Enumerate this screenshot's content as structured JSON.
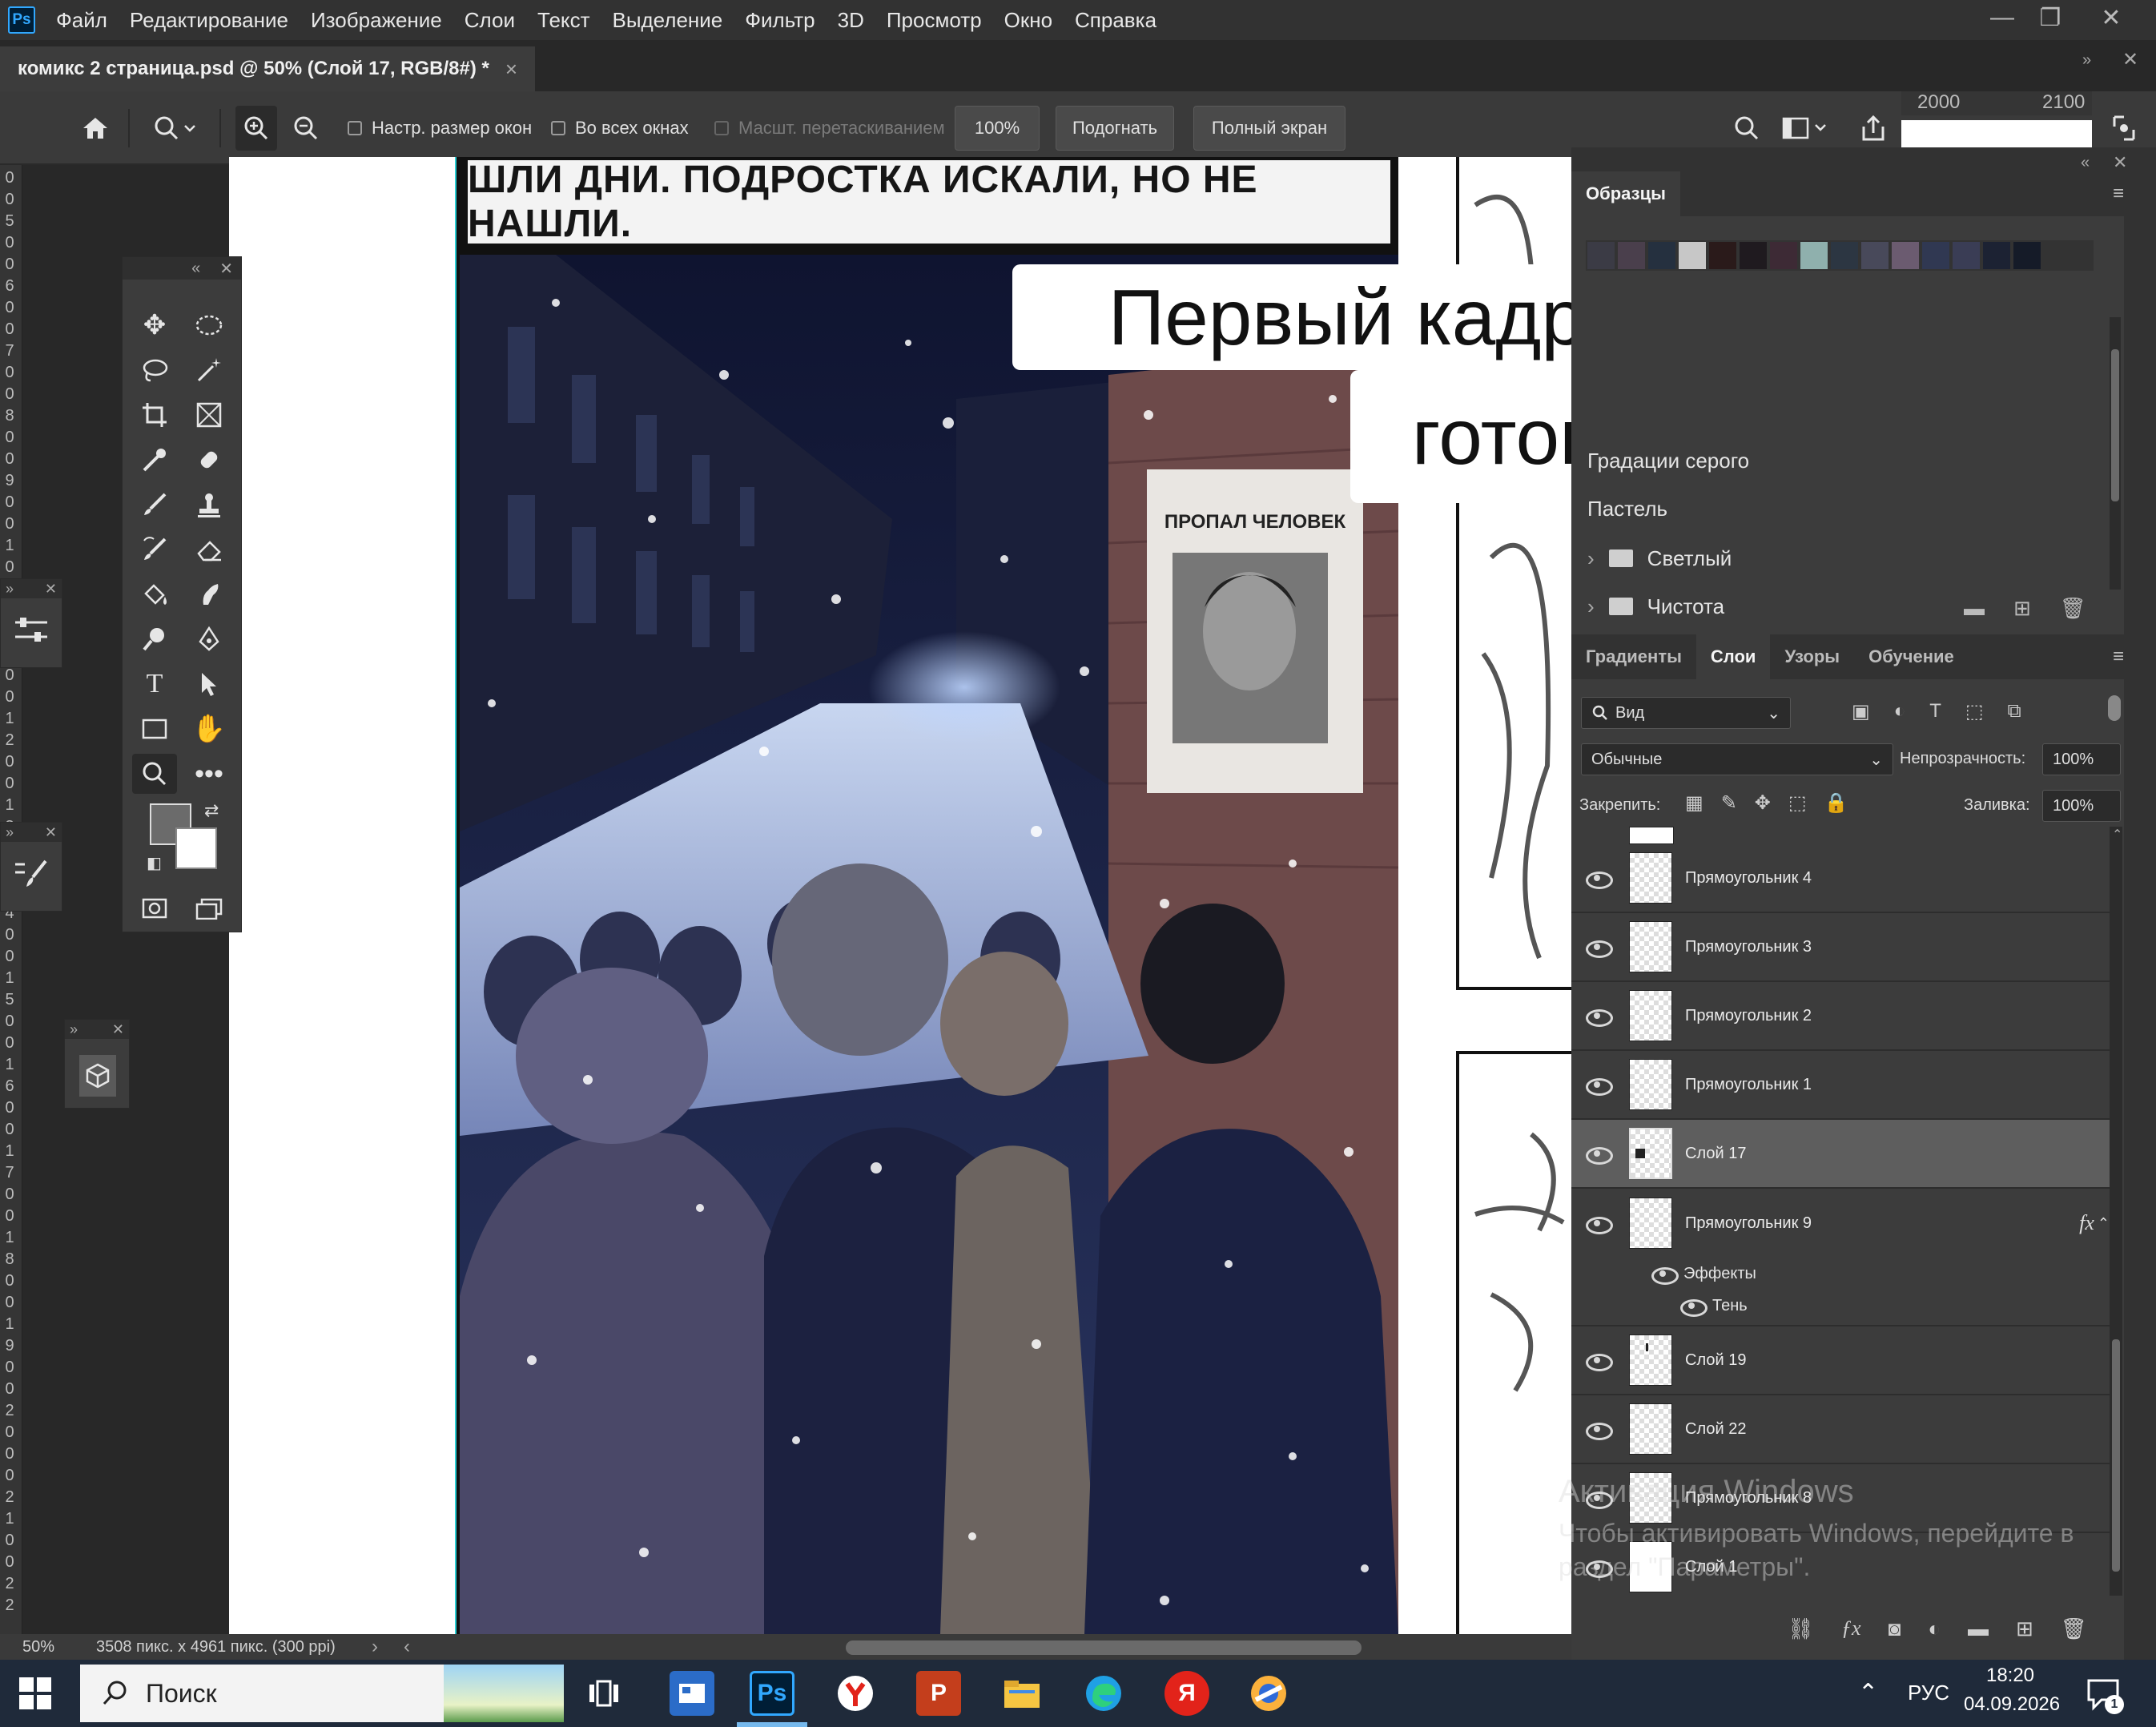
{
  "app": {
    "logo": "Ps",
    "menu": [
      "Файл",
      "Редактирование",
      "Изображение",
      "Слои",
      "Текст",
      "Выделение",
      "Фильтр",
      "3D",
      "Просмотр",
      "Окно",
      "Справка"
    ]
  },
  "document": {
    "tab_title": "комикс 2 страница.psd @ 50% (Слой 17, RGB/8#) *",
    "close_glyph": "×"
  },
  "options": {
    "resize_windows": "Настр. размер окон",
    "all_windows": "Во всех окнах",
    "scrubby_zoom": "Масшт. перетаскиванием",
    "zoom_value": "100%",
    "fit": "Подогнать",
    "fullscreen": "Полный экран"
  },
  "ruler": {
    "top_labels": [
      "2000",
      "2100"
    ],
    "left_labels": [
      "0",
      "0",
      "5",
      "0",
      "0",
      "6",
      "0",
      "0",
      "7",
      "0",
      "0",
      "8",
      "0",
      "0",
      "9",
      "0",
      "0",
      "1",
      "0",
      "0",
      "0",
      "1",
      "1",
      "0",
      "0",
      "1",
      "2",
      "0",
      "0",
      "1",
      "3",
      "0",
      "0",
      "1",
      "4",
      "0",
      "0",
      "1",
      "5",
      "0",
      "0",
      "1",
      "6",
      "0",
      "0",
      "1",
      "7",
      "0",
      "0",
      "1",
      "8",
      "0",
      "0",
      "1",
      "9",
      "0",
      "0",
      "2",
      "0",
      "0",
      "0",
      "2",
      "1",
      "0",
      "0",
      "2",
      "2"
    ]
  },
  "canvas": {
    "caption": "ШЛИ ДНИ. ПОДРОСТКА ИСКАЛИ, НО НЕ НАШЛИ.",
    "poster_title": "ПРОПАЛ ЧЕЛОВЕК"
  },
  "overlay": {
    "line1": "Первый кадр комикса",
    "line2": "готов"
  },
  "swatches_panel": {
    "tab": "Образцы",
    "colors": [
      "#3b3b45",
      "#4a3f4c",
      "#25303f",
      "#c7c7c7",
      "#2a1a1a",
      "#1f1a1f",
      "#3d2a35",
      "#8fb0ad",
      "#2c3642",
      "#48495a",
      "#6b5b70",
      "#303852",
      "#3a3d55",
      "#1c2233",
      "#151b28"
    ],
    "folders": [
      {
        "label": "Градации серого"
      },
      {
        "label": "Пастель"
      },
      {
        "label": "Светлый"
      },
      {
        "label": "Чистота"
      }
    ]
  },
  "layers_panel": {
    "tabs": [
      "Градиенты",
      "Слои",
      "Узоры",
      "Обучение"
    ],
    "active_tab": "Слои",
    "filter_label": "Вид",
    "blend_mode": "Обычные",
    "opacity_label": "Непрозрачность:",
    "opacity_value": "100%",
    "lock_label": "Закрепить:",
    "fill_label": "Заливка:",
    "fill_value": "100%",
    "layers": [
      {
        "name": "Прямоугольник 4"
      },
      {
        "name": "Прямоугольник 3"
      },
      {
        "name": "Прямоугольник 2"
      },
      {
        "name": "Прямоугольник 1"
      },
      {
        "name": "Слой 17"
      },
      {
        "name": "Прямоугольник 9"
      },
      {
        "name": "Слой 19"
      },
      {
        "name": "Слой 22"
      },
      {
        "name": "Прямоугольник 8"
      },
      {
        "name": "Слой 1"
      }
    ],
    "effects_label": "Эффекты",
    "shadow_label": "Тень",
    "fx_label": "fx"
  },
  "status": {
    "zoom": "50%",
    "doc_size": "3508 пикс. x 4961 пикс. (300 ppi)"
  },
  "watermark": {
    "line1": "Активация Windows",
    "line2": "Чтобы активировать Windows, перейдите в",
    "line3": "раздел \"Параметры\"."
  },
  "taskbar": {
    "search_placeholder": "Поиск",
    "ps_label": "Ps",
    "yandex_label": "Я",
    "lang": "РУС",
    "time": "18:20",
    "date": "04.09.2026",
    "notif_count": "1"
  }
}
